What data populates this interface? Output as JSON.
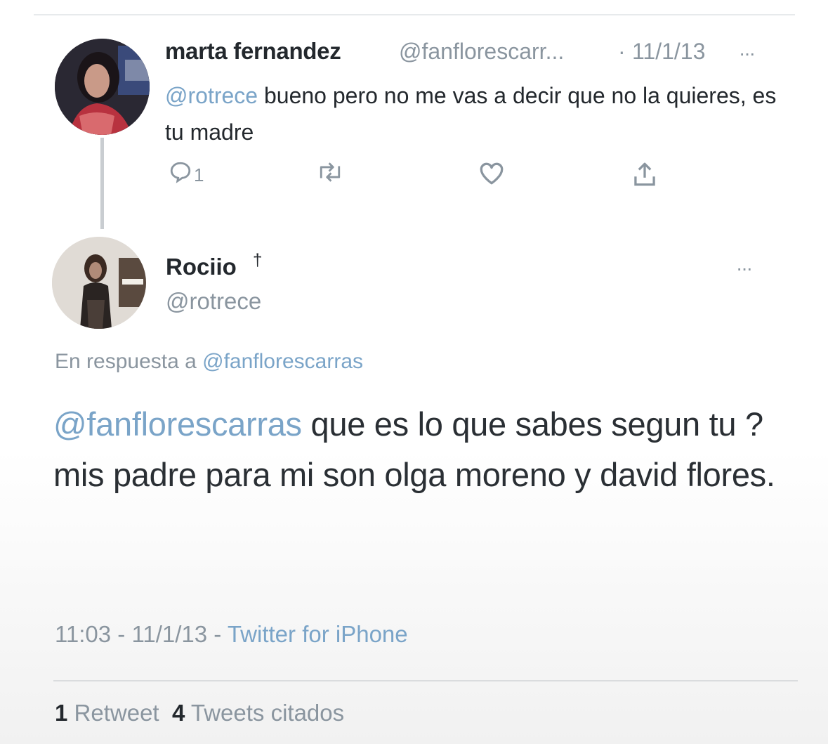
{
  "parent_tweet": {
    "name": "marta fernandez",
    "handle": "@fanflorescarr...",
    "separator": "·",
    "date": "11/1/13",
    "more": "···",
    "mention": "@rotrece",
    "text": " bueno pero no me vas a decir que no la quieres, es tu madre",
    "reply_count": "1",
    "icons": [
      "reply-icon",
      "retweet-icon",
      "like-icon",
      "share-icon"
    ]
  },
  "main_tweet": {
    "name": "Rociio",
    "name_symbol": "†",
    "handle": "@rotrece",
    "more": "···",
    "reply_prefix": "En respuesta a ",
    "reply_handle": "@fanflorescarras",
    "mention": "@fanflorescarras",
    "text": " que es lo que sabes segun tu ? mis padre para mi son olga moreno y david flores.",
    "time_date": "11:03 - 11/1/13 - ",
    "source": "Twitter for iPhone",
    "retweets_count": "1",
    "retweets_label": " Retweet",
    "quotes_count": "4",
    "quotes_label": " Tweets citados"
  },
  "colors": {
    "link": "#7aa4c8",
    "muted": "#8a959f",
    "text": "#23282d"
  }
}
